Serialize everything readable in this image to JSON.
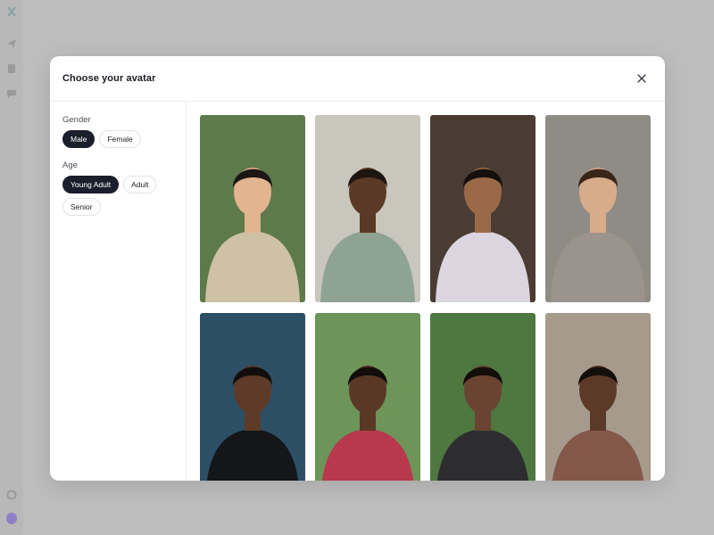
{
  "modal": {
    "title": "Choose your avatar"
  },
  "filters": {
    "gender": {
      "label": "Gender",
      "options": [
        "Male",
        "Female"
      ],
      "selected": "Male"
    },
    "age": {
      "label": "Age",
      "options": [
        "Young Adult",
        "Adult",
        "Senior"
      ],
      "selected": "Young Adult"
    }
  },
  "icons": {
    "close": "close-icon",
    "rail": [
      "logo-icon",
      "send-icon",
      "document-icon",
      "chat-icon",
      "settings-icon",
      "user-avatar-icon"
    ]
  },
  "colors": {
    "accent": "#1b1f2b",
    "backdrop": "#bdbdbd",
    "surface": "#ffffff"
  },
  "avatars": [
    {
      "bg": "#5d7a4a",
      "skin": "#e2b48f",
      "hair": "#1c1714",
      "shirt": "#cfc1a6"
    },
    {
      "bg": "#c9c6bc",
      "skin": "#5a3a26",
      "hair": "#1d1510",
      "shirt": "#8fa393"
    },
    {
      "bg": "#4a3c33",
      "skin": "#9a6a48",
      "hair": "#15100d",
      "shirt": "#dcd5df"
    },
    {
      "bg": "#8f8c86",
      "skin": "#d8ab8b",
      "hair": "#3a2619",
      "shirt": "#9b948c"
    },
    {
      "bg": "#2d4f66",
      "skin": "#5d3b28",
      "hair": "#120d0a",
      "shirt": "#14161a"
    },
    {
      "bg": "#6d9459",
      "skin": "#5a3826",
      "hair": "#120d0a",
      "shirt": "#b8384c"
    },
    {
      "bg": "#4f7740",
      "skin": "#6a4430",
      "hair": "#140e0b",
      "shirt": "#2d2d30"
    },
    {
      "bg": "#a69a8d",
      "skin": "#5c3a28",
      "hair": "#150f0c",
      "shirt": "#83574a"
    }
  ]
}
